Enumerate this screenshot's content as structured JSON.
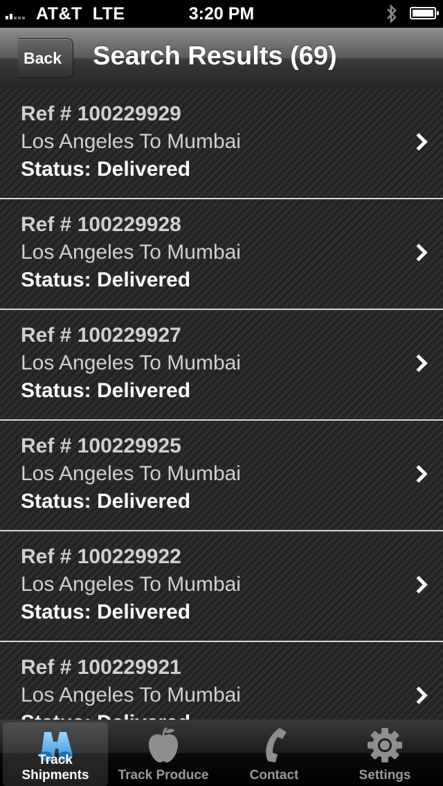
{
  "status_bar": {
    "carrier": "AT&T",
    "network": "LTE",
    "time": "3:20 PM"
  },
  "nav": {
    "back_label": "Back",
    "title": "Search Results (69)"
  },
  "results": [
    {
      "ref": "Ref # 100229929",
      "route": "Los Angeles To Mumbai",
      "status": "Status: Delivered"
    },
    {
      "ref": "Ref # 100229928",
      "route": "Los Angeles To Mumbai",
      "status": "Status: Delivered"
    },
    {
      "ref": "Ref # 100229927",
      "route": "Los Angeles To Mumbai",
      "status": "Status: Delivered"
    },
    {
      "ref": "Ref # 100229925",
      "route": "Los Angeles To Mumbai",
      "status": "Status: Delivered"
    },
    {
      "ref": "Ref # 100229922",
      "route": "Los Angeles To Mumbai",
      "status": "Status: Delivered"
    },
    {
      "ref": "Ref # 100229921",
      "route": "Los Angeles To Mumbai",
      "status": "Status: Delivered"
    }
  ],
  "tabs": [
    {
      "label": "Track Shipments",
      "icon": "binoculars-icon",
      "active": true
    },
    {
      "label": "Track Produce",
      "icon": "apple-icon",
      "active": false
    },
    {
      "label": "Contact",
      "icon": "phone-icon",
      "active": false
    },
    {
      "label": "Settings",
      "icon": "gear-icon",
      "active": false
    }
  ],
  "colors": {
    "active_tab_icon": "#4aa8e8",
    "inactive_tab_icon": "#8a8a8a",
    "list_text": "#d0d0d0"
  }
}
